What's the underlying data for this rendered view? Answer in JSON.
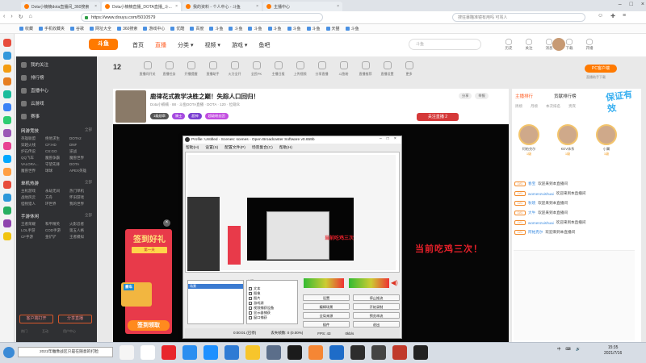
{
  "browser": {
    "tabs": [
      {
        "label": "Dota小楠楠dota直播间_360搜索",
        "active": false
      },
      {
        "label": "Dota小楠楠直播_DOTA直播_斗...",
        "active": true
      },
      {
        "label": "我的资料 - 个人中心 - 斗鱼",
        "active": false
      },
      {
        "label": "主播中心",
        "active": false
      }
    ],
    "url": "https://www.douyu.com/5010579",
    "search_placeholder": "搜狂暴瞄准镜有用吗 可骂人",
    "nav_icons": [
      "back-icon",
      "forward-icon",
      "refresh-icon",
      "home-icon"
    ],
    "bookmarks": [
      "收藏",
      "手机收藏夹",
      "谷歌",
      "网址大全",
      "360搜索",
      "游戏中心",
      "优酷",
      "百度",
      "斗鱼",
      "斗鱼",
      "斗鱼",
      "斗鱼",
      "斗鱼",
      "斗鱼",
      "天猫",
      "斗鱼"
    ]
  },
  "site": {
    "logo": "斗鱼",
    "nav": [
      "首页",
      "直播",
      "分类 ▾",
      "视频 ▾",
      "游戏 ▾",
      "鱼吧"
    ],
    "nav_active": "直播",
    "search_placeholder": "斗鱼",
    "header_icons": [
      {
        "label": "历史",
        "icon": "history-icon"
      },
      {
        "label": "关注",
        "icon": "follow-icon"
      },
      {
        "label": "消息",
        "icon": "message-icon"
      },
      {
        "label": "下载",
        "icon": "download-icon"
      },
      {
        "label": "开播",
        "icon": "broadcast-icon"
      }
    ]
  },
  "sidebar": {
    "items": [
      {
        "label": "我的关注",
        "icon": "heart-icon"
      },
      {
        "label": "排行榜",
        "icon": "rank-icon"
      },
      {
        "label": "直播中心",
        "icon": "center-icon"
      },
      {
        "label": "云游戏",
        "icon": "cloud-icon"
      },
      {
        "label": "赛事",
        "icon": "trophy-icon"
      }
    ],
    "sections": [
      {
        "title": "网游竞技",
        "more": "全部",
        "items": [
          "英雄联盟",
          "绝地求生",
          "DOTA2",
          "穿越火线",
          "CF:HD",
          "DNF",
          "炉石传说",
          "CS:GO",
          "逆战",
          "QQ飞车",
          "魔兽争霸",
          "魔兽世界",
          "VALORA...",
          "守望先锋",
          "DOTA",
          "魔兽世界",
          "球球",
          "APEX英雄"
        ]
      },
      {
        "title": "单机热游",
        "more": "全部",
        "items": [
          "主机游戏",
          "永劫无间",
          "热门单机",
          "战地风云",
          "方舟",
          "怀旧游戏",
          "怪物猎人",
          "环世界",
          "我的世界"
        ]
      },
      {
        "title": "手游休闲",
        "more": "全部",
        "items": [
          "王者荣耀",
          "和平精英",
          "火影忍者",
          "LOL手游",
          "COD手游",
          "第五人格",
          "CF手游",
          "金铲铲",
          "王者模拟"
        ]
      }
    ],
    "buttons": [
      "客户端打开",
      "分享直播"
    ],
    "footer": [
      "热门",
      "互动",
      "用户中心"
    ]
  },
  "toolbar": {
    "count": "12",
    "count_label": "主播任务",
    "tools": [
      "直播间开关",
      "直播任务",
      "开播提醒",
      "直播助手",
      "火力全开",
      "全民PK",
      "主播日报",
      "上传视频",
      "分享直播",
      "斗鱼粉",
      "直播推荐",
      "直播设置",
      "更多"
    ],
    "pc_button": "PC客户端",
    "pc_sub": "直播助手下载"
  },
  "stream": {
    "title": "鹿律花式教学决胜之巅！失踪人口回归！",
    "meta": "Dota小楠楠 · 88 · 斗鱼DOTA直播 · DOTA · 120 · 位观众",
    "tags": [
      "1级勋章",
      "骑士",
      "超神",
      "超级粉丝团"
    ],
    "buttons": [
      "分享",
      "举报"
    ],
    "follow": "关注直播 2",
    "overlay_text": "当前吃鸡三次！",
    "promo": {
      "title": "签到好礼",
      "day": "第一天",
      "badge": "豪车",
      "button": "签到领取",
      "close": "×"
    }
  },
  "obs": {
    "title": "Profile: Untitled - Scenes: scenes - Open Broadcaster Software v0.659b",
    "menu": [
      "帮助(H)",
      "设置(S)",
      "配置文件(P)",
      "场景集合(C)",
      "帮助(H)"
    ],
    "scene_selected": "场景",
    "sources_label": "来源:",
    "sources": [
      "文本",
      "图像",
      "图片",
      "游戏源",
      "视频捕获设备",
      "显示器捕获",
      "窗口捕获"
    ],
    "buttons": [
      "设置",
      "停止推流",
      "编辑场景",
      "开始录制",
      "全局来源",
      "预览串流",
      "插件",
      "退出"
    ],
    "status": [
      "0:00:01 (已停)",
      "丢失帧数: 0 (0.00%)",
      "FPS: 43",
      "0kb/s"
    ],
    "nested_red": "当前吃鸡三次"
  },
  "right_panel": {
    "tabs": [
      "主播排行",
      "贡献排行榜"
    ],
    "subs": [
      "周榜",
      "月榜",
      "本次排名",
      "贵宾"
    ],
    "badge": "保证有效",
    "ranks": [
      {
        "name": "阿帕克尔",
        "level": "1级"
      },
      {
        "name": "KEV体系",
        "level": "1级"
      },
      {
        "name": "小翼",
        "level": "1级"
      }
    ],
    "messages": [
      {
        "level": "LV1",
        "name": "春宝",
        "text": "欢迎来到本直播间"
      },
      {
        "level": "LV1",
        "name": "womenzuishuai",
        "text": "欢迎来到本直播间"
      },
      {
        "level": "LV1",
        "name": "秋晓",
        "text": "欢迎来到本直播间"
      },
      {
        "level": "LV1",
        "name": "大牛",
        "text": "欢迎来到本直播间"
      },
      {
        "level": "LV1",
        "name": "womenzuishuai",
        "text": "欢迎来到本直播间"
      },
      {
        "level": "LV1",
        "name": "阿帕克尔",
        "text": "欢迎来到本直播间"
      }
    ]
  },
  "taskbar": {
    "search": "2021年雕像战区只是在随意的打脸",
    "tray": [
      "中",
      "⌨",
      "🔊"
    ],
    "time": "15:35",
    "date": "2021/7/16"
  }
}
